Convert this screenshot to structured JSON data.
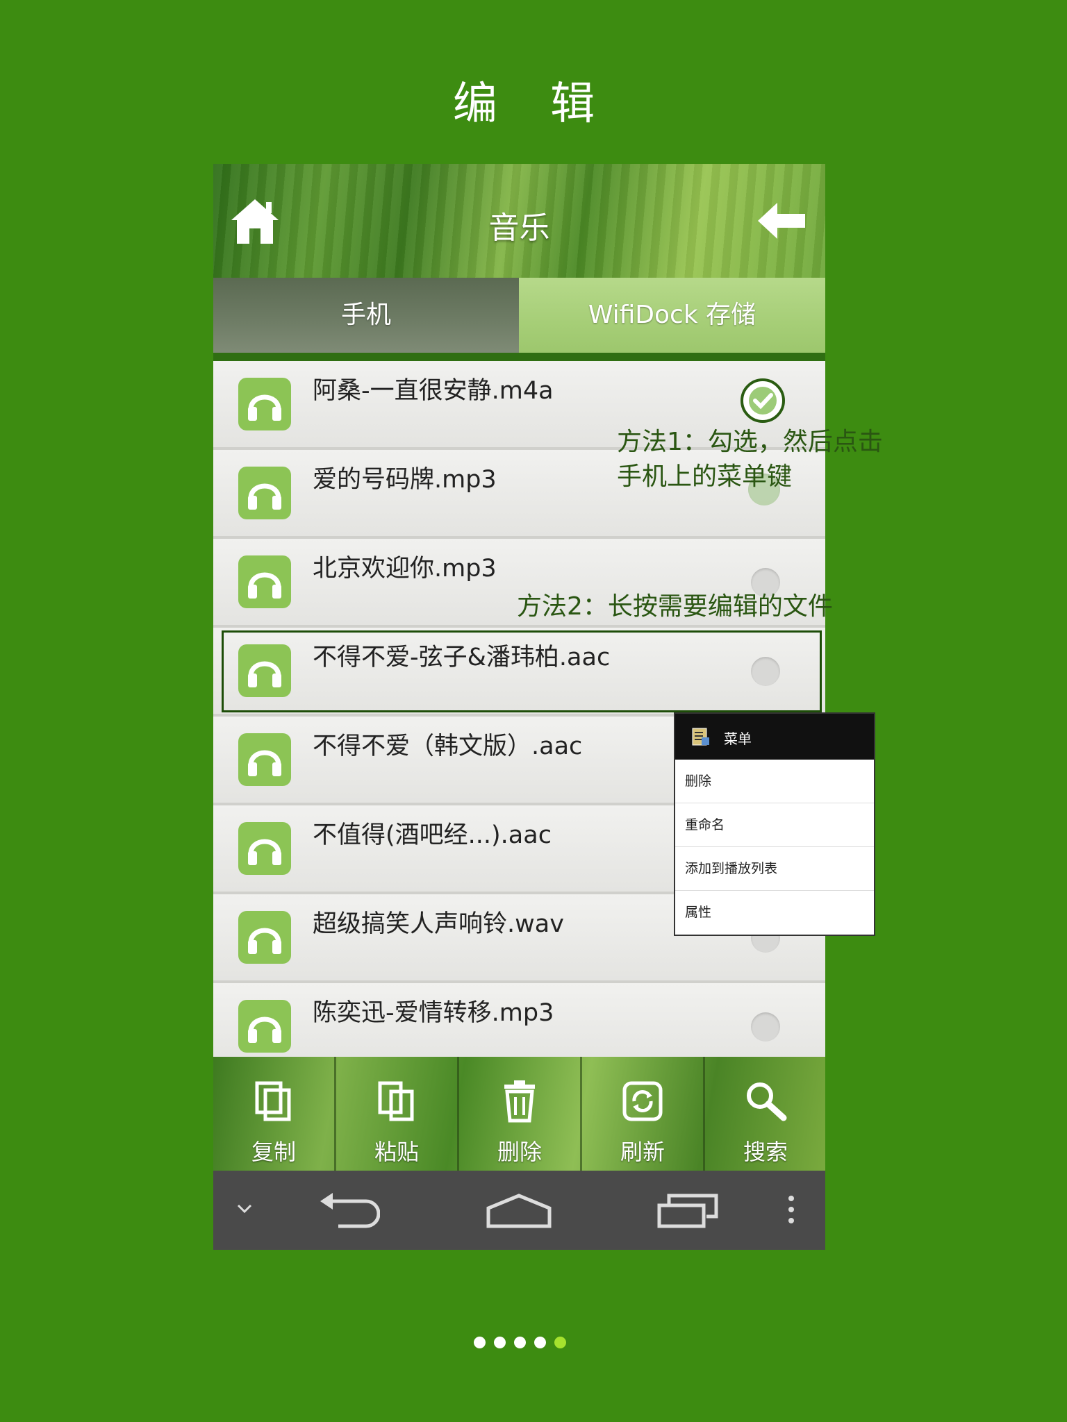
{
  "page": {
    "title": "编 辑"
  },
  "appbar": {
    "title": "音乐",
    "home_icon": "home-icon",
    "back_icon": "back-arrow-icon"
  },
  "tabs": [
    {
      "label": "手机"
    },
    {
      "label": "WifiDock 存储"
    }
  ],
  "files": [
    {
      "name": "阿桑-一直很安静.m4a",
      "checked": true
    },
    {
      "name": "爱的号码牌.mp3",
      "checked": true
    },
    {
      "name": "北京欢迎你.mp3",
      "checked": false
    },
    {
      "name": "不得不爱-弦子&潘玮柏.aac",
      "checked": false
    },
    {
      "name": "不得不爱（韩文版）.aac",
      "checked": false
    },
    {
      "name": "不值得(酒吧经...).aac",
      "checked": false
    },
    {
      "name": "超级搞笑人声响铃.wav",
      "checked": false
    },
    {
      "name": "陈奕迅-爱情转移.mp3",
      "checked": false
    }
  ],
  "annotations": {
    "method1_line1": "方法1：勾选，然后点击",
    "method1_line2": "手机上的菜单键",
    "method2": "方法2：长按需要编辑的文件"
  },
  "context_menu": {
    "title": "菜单",
    "items": [
      "删除",
      "重命名",
      "添加到播放列表",
      "属性"
    ]
  },
  "toolbar": [
    {
      "label": "复制",
      "icon": "copy-icon"
    },
    {
      "label": "粘贴",
      "icon": "paste-icon"
    },
    {
      "label": "删除",
      "icon": "trash-icon"
    },
    {
      "label": "刷新",
      "icon": "refresh-icon"
    },
    {
      "label": "搜索",
      "icon": "search-icon"
    }
  ],
  "navbar": {
    "icons": [
      "collapse-icon",
      "back-nav-icon",
      "home-nav-icon",
      "recents-icon",
      "overflow-menu-icon"
    ]
  },
  "pager": {
    "count": 5,
    "active_index": 4
  },
  "colors": {
    "background": "#3d8c11",
    "accent": "#8cc455",
    "annotation": "#2a5612"
  }
}
